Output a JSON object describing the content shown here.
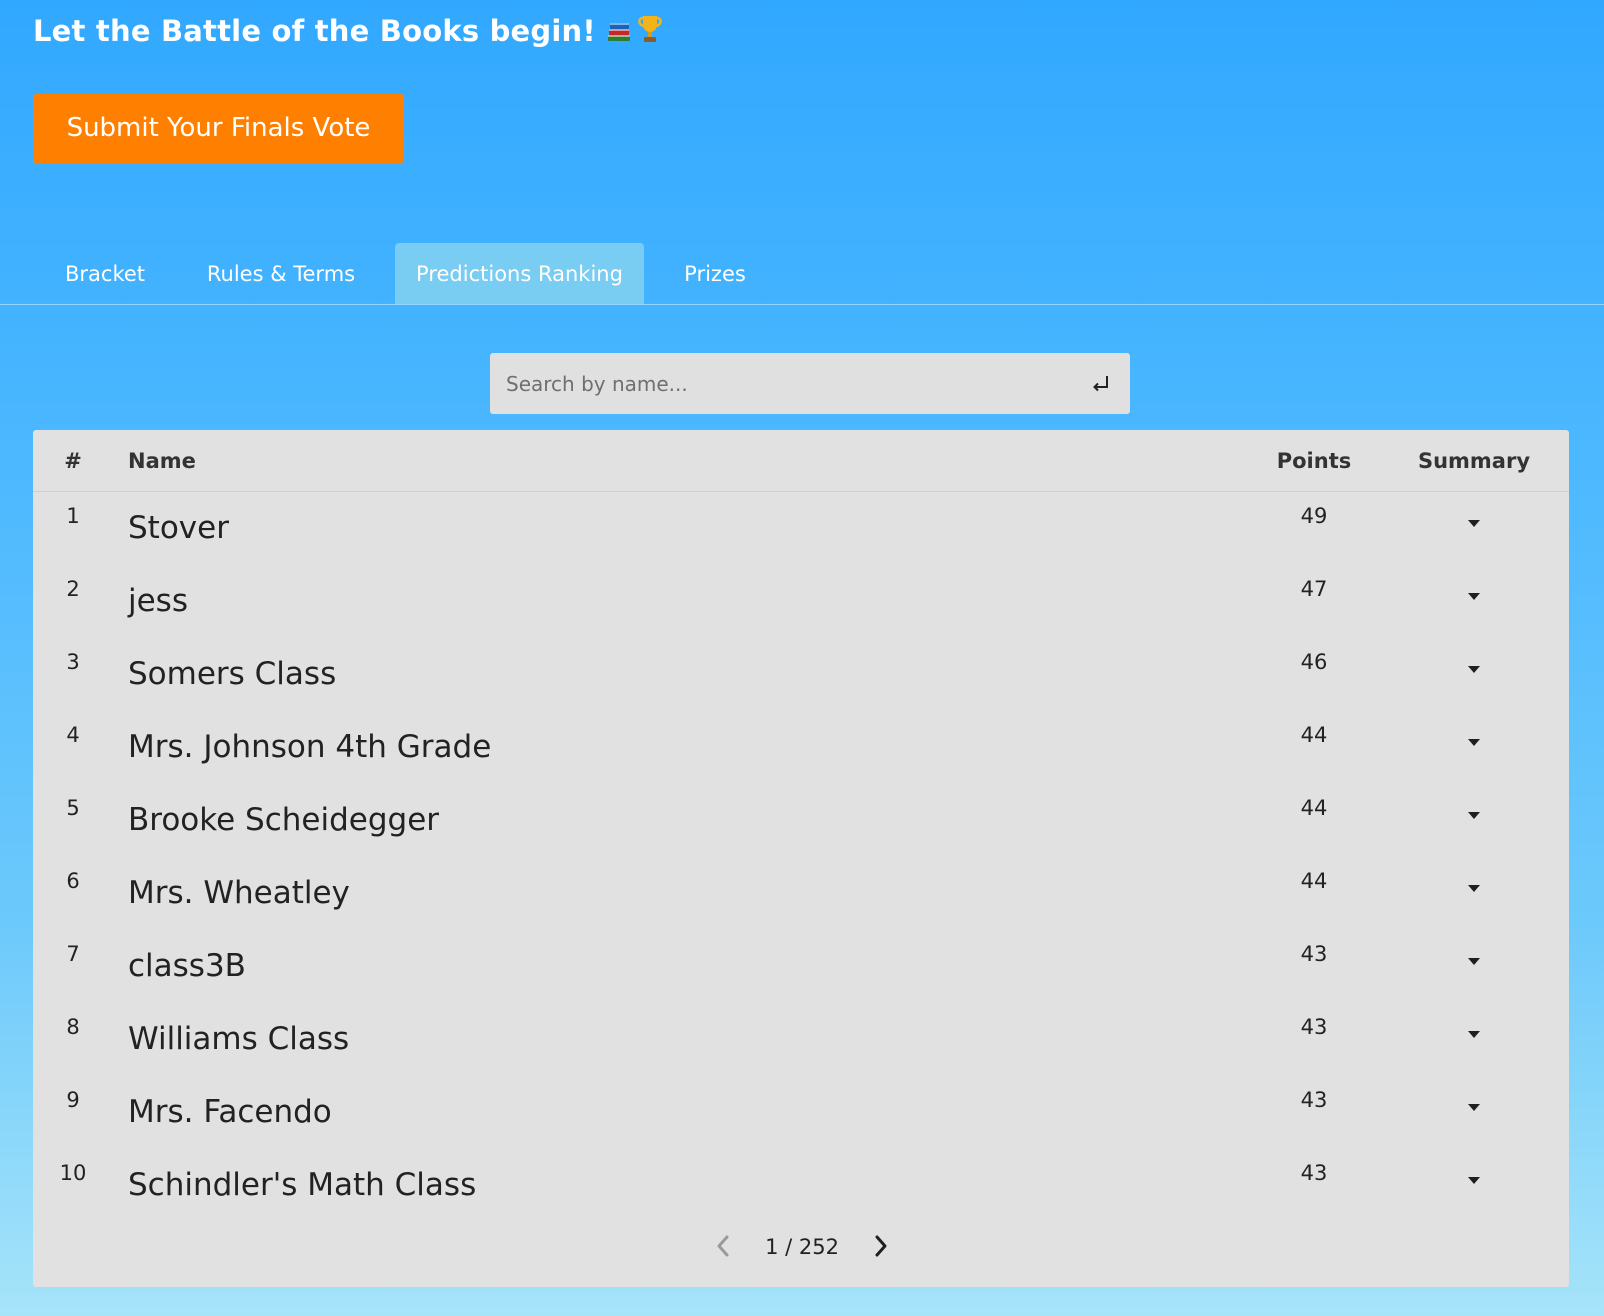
{
  "header": {
    "title": "Let the Battle of the Books begin!",
    "title_icons": [
      "books-emoji",
      "trophy-emoji"
    ],
    "cta_label": "Submit Your Finals Vote"
  },
  "tabs": [
    {
      "label": "Bracket",
      "active": false
    },
    {
      "label": "Rules & Terms",
      "active": false
    },
    {
      "label": "Predictions Ranking",
      "active": true
    },
    {
      "label": "Prizes",
      "active": false
    }
  ],
  "search": {
    "placeholder": "Search by name...",
    "value": "",
    "submit_icon": "enter-icon"
  },
  "table": {
    "columns": [
      "#",
      "Name",
      "Points",
      "Summary"
    ],
    "rows": [
      {
        "rank": "1",
        "name": "Stover",
        "points": "49"
      },
      {
        "rank": "2",
        "name": "jess",
        "points": "47"
      },
      {
        "rank": "3",
        "name": "Somers Class",
        "points": "46"
      },
      {
        "rank": "4",
        "name": "Mrs. Johnson 4th Grade",
        "points": "44"
      },
      {
        "rank": "5",
        "name": "Brooke Scheidegger",
        "points": "44"
      },
      {
        "rank": "6",
        "name": "Mrs. Wheatley",
        "points": "44"
      },
      {
        "rank": "7",
        "name": "class3B",
        "points": "43"
      },
      {
        "rank": "8",
        "name": "Williams Class",
        "points": "43"
      },
      {
        "rank": "9",
        "name": "Mrs. Facendo",
        "points": "43"
      },
      {
        "rank": "10",
        "name": "Schindler's Math Class",
        "points": "43"
      }
    ]
  },
  "pagination": {
    "text": "1 / 252",
    "current_page": 1,
    "total_pages": 252
  },
  "colors": {
    "background_top": "#31a8ff",
    "background_bottom": "#a6e4f9",
    "cta": "#ff8000",
    "active_tab": "#79ccf2",
    "card": "#e1e1e1"
  }
}
